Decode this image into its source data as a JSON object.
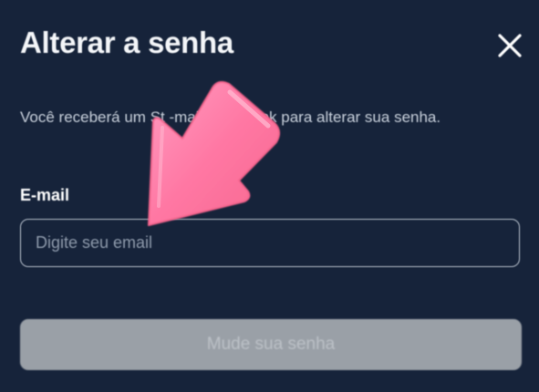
{
  "dialog": {
    "title": "Alterar a senha",
    "description": "Você receberá um St      -mail com o link para alterar sua senha.",
    "email_label": "E-mail",
    "email_placeholder": "Digite seu email",
    "email_value": "",
    "submit_label": "Mude sua senha",
    "close_icon": "close-icon"
  },
  "colors": {
    "background": "#16233a",
    "input_border": "#b7c0cc",
    "button_disabled": "#9aa0a7",
    "annotation_arrow": "#ff7fa8"
  }
}
